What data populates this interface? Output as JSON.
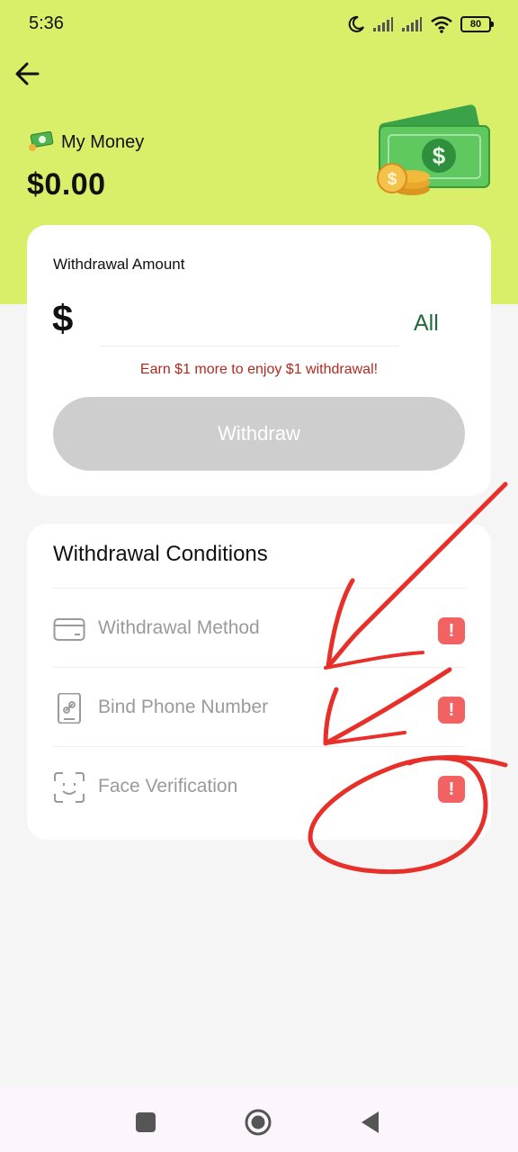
{
  "status_bar": {
    "time": "5:36",
    "battery": "80",
    "icons": [
      "moon-icon",
      "signal-icon",
      "signal-icon",
      "wifi-icon",
      "battery-icon"
    ]
  },
  "header": {
    "back_icon": "arrow-left-icon",
    "money_label": "My Money",
    "balance": "$0.00"
  },
  "withdraw": {
    "label": "Withdrawal Amount",
    "currency": "$",
    "input_value": "",
    "all_label": "All",
    "promo": "Earn $1 more to enjoy $1 withdrawal!",
    "button_label": "Withdraw"
  },
  "conditions": {
    "title": "Withdrawal Conditions",
    "items": [
      {
        "label": "Withdrawal Method",
        "icon": "card-icon",
        "status": "!"
      },
      {
        "label": "Bind Phone Number",
        "icon": "phone-link-icon",
        "status": "!"
      },
      {
        "label": "Face Verification",
        "icon": "face-scan-icon",
        "status": "!"
      }
    ]
  },
  "colors": {
    "header_bg": "#d9ef6a",
    "alert": "#f26262",
    "all_link": "#1f6b3a",
    "promo": "#b02a20",
    "annotation": "#e8302a"
  },
  "nav": {
    "items": [
      "recents-square-icon",
      "home-circle-icon",
      "back-triangle-icon"
    ]
  }
}
